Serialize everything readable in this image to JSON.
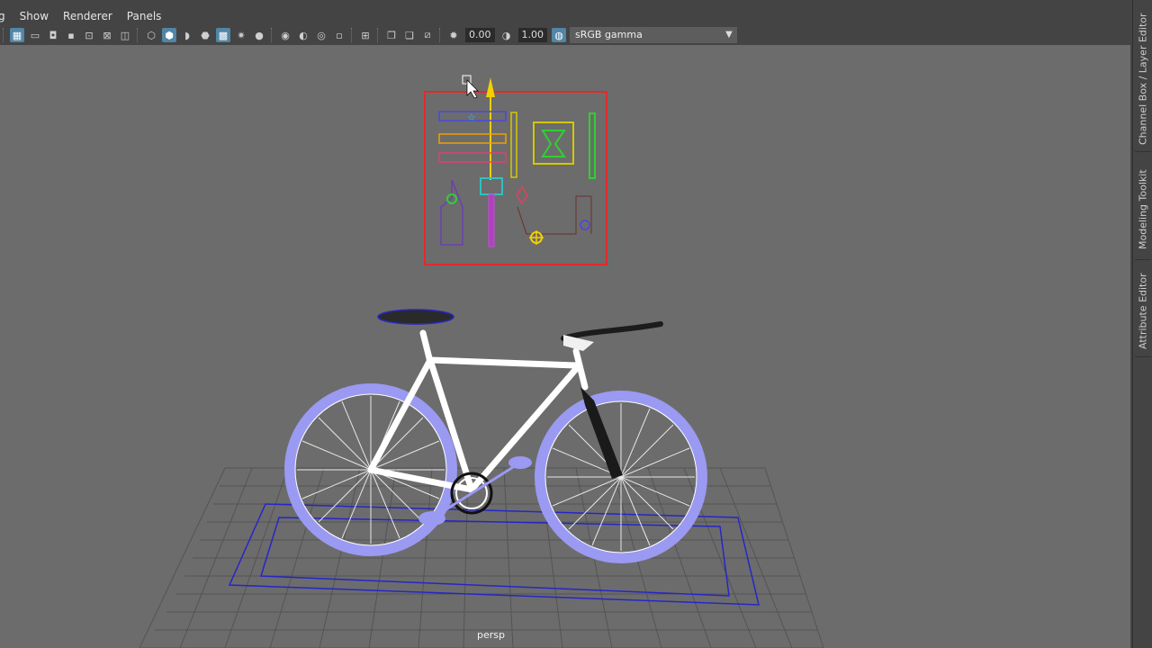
{
  "menubar": {
    "items": [
      "g",
      "Show",
      "Renderer",
      "Panels"
    ]
  },
  "toolbar": {
    "exposure_value": "0.00",
    "gamma_value": "1.00",
    "color_space": "sRGB gamma",
    "icons": [
      "grid-icon",
      "single-view-icon",
      "camera-icon",
      "film-gate-icon",
      "resolution-gate-icon",
      "safe-action-icon",
      "wireframe-icon",
      "smooth-shade-icon",
      "shade-all-icon",
      "wireframe-on-shaded-icon",
      "xray-icon",
      "use-lights-icon",
      "shadows-icon",
      "ambient-occlusion-icon",
      "motion-blur-icon",
      "anti-alias-icon",
      "isolate-select-icon",
      "xray-joints-icon",
      "xray-active-icon",
      "backface-icon",
      "exposure-icon",
      "gamma-icon",
      "color-management-icon"
    ]
  },
  "viewport": {
    "camera_label": "persp"
  },
  "sidetabs": {
    "items": [
      "Channel Box / Layer Editor",
      "Modeling Toolkit",
      "Attribute Editor"
    ]
  },
  "colors": {
    "accent": "#5285a6",
    "viewport_bg": "#6c6c6c",
    "selection_red": "#e02a2a",
    "highlight_blue": "#2626c8"
  }
}
